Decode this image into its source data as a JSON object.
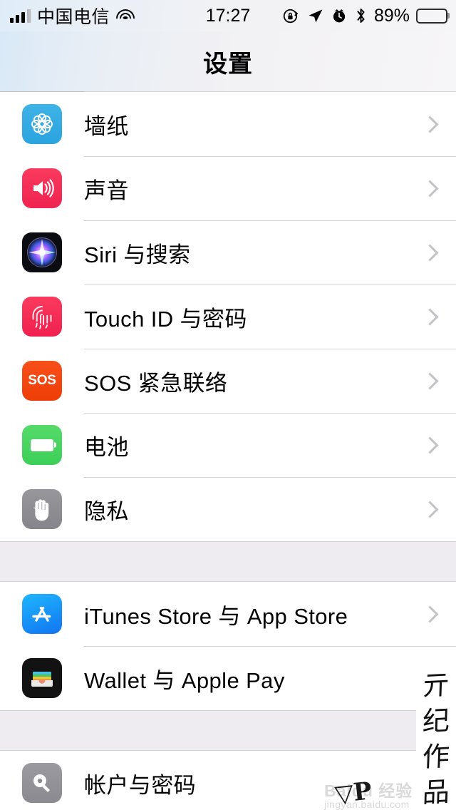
{
  "status_bar": {
    "signal_icon": "cellular-bars-icon",
    "carrier": "中国电信",
    "wifi_icon": "wifi-icon",
    "time": "17:27",
    "rotation_lock_icon": "rotation-lock-icon",
    "location_icon": "location-arrow-icon",
    "alarm_icon": "alarm-clock-icon",
    "bluetooth_icon": "bluetooth-icon",
    "battery_percent": "89%",
    "battery_icon": "battery-full-icon"
  },
  "nav": {
    "title": "设置"
  },
  "sections": [
    {
      "rows": [
        {
          "label": "墙纸",
          "icon": "wallpaper-icon",
          "accessory": "chevron-right-icon"
        },
        {
          "label": "声音",
          "icon": "sounds-speaker-icon",
          "accessory": "chevron-right-icon"
        },
        {
          "label": "Siri 与搜索",
          "icon": "siri-icon",
          "accessory": "chevron-right-icon"
        },
        {
          "label": "Touch ID 与密码",
          "icon": "touch-id-fingerprint-icon",
          "accessory": "chevron-right-icon"
        },
        {
          "label": "SOS 紧急联络",
          "icon": "sos-icon",
          "accessory": "chevron-right-icon",
          "icon_text": "SOS"
        },
        {
          "label": "电池",
          "icon": "battery-icon",
          "accessory": "chevron-right-icon"
        },
        {
          "label": "隐私",
          "icon": "privacy-hand-icon",
          "accessory": "chevron-right-icon"
        }
      ]
    },
    {
      "rows": [
        {
          "label": "iTunes Store 与 App Store",
          "icon": "app-store-icon",
          "accessory": "chevron-right-icon"
        },
        {
          "label": "Wallet 与 Apple Pay",
          "icon": "wallet-icon",
          "accessory": "chevron-right-icon"
        }
      ]
    },
    {
      "rows": [
        {
          "label": "帐户与密码",
          "icon": "accounts-passwords-icon",
          "accessory": "chevron-right-icon"
        }
      ]
    }
  ],
  "overlays": {
    "signature_chars": [
      "亓",
      "纪",
      "作",
      "品"
    ],
    "watermark_brand": "Baidu 经验",
    "watermark_url": "jingyan.baidu.com",
    "watermark_mark": "▽P"
  },
  "colors": {
    "wallpaper": "#2ba3de",
    "sounds": "#f5365c",
    "siri": "#0b0b12",
    "touch_id": "#f5265a",
    "sos": "#f0400c",
    "battery": "#48cf5c",
    "privacy": "#8b8b91",
    "app_store": "#1175f0",
    "wallet": "#121212",
    "accounts": "#8e8e94",
    "separator": "#d5d5d7",
    "gap_background": "#eeecf1",
    "chevron": "#c3c3c7"
  }
}
